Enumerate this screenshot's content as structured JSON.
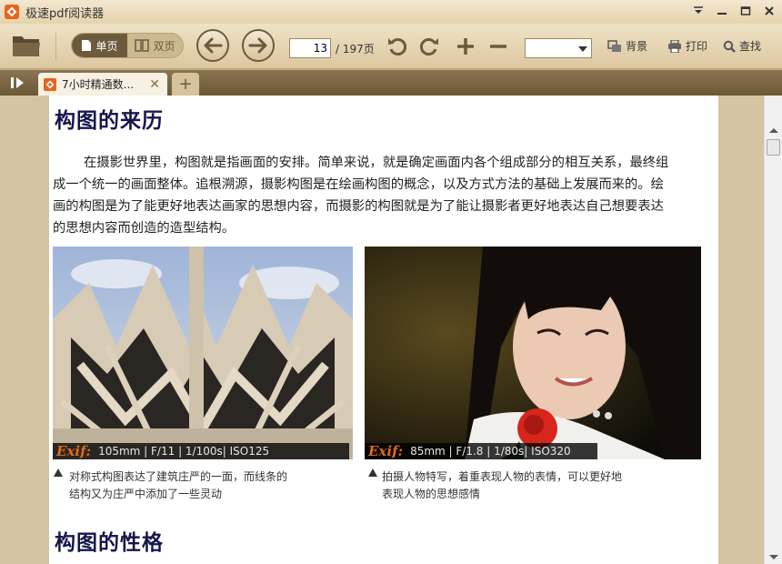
{
  "window": {
    "title": "极速pdf阅读器"
  },
  "toolbar": {
    "single_page_label": "单页",
    "double_page_label": "双页",
    "current_page": "13",
    "total_pages": "/ 197页",
    "zoom_value": "",
    "background_label": "背景",
    "print_label": "打印",
    "search_label": "查找"
  },
  "tabs": [
    {
      "label": "7小时精通数..."
    }
  ],
  "document": {
    "heading1": "构图的来历",
    "paragraph": "在摄影世界里，构图就是指画面的安排。简单来说，就是确定画面内各个组成部分的相互关系，最终组成一个统一的画面整体。追根溯源，摄影构图是在绘画构图的概念，以及方式方法的基础上发展而来的。绘画的构图是为了能更好地表达画家的思想内容，而摄影的构图就是为了能让摄影者更好地表达自己想要表达的思想内容而创造的造型结构。",
    "photo_left": {
      "exif_logo": "Exif:",
      "exif": "105mm | F/11 | 1/100s| ISO125",
      "caption_line1": "对称式构图表达了建筑庄严的一面，而线条的",
      "caption_line2": "结构又为庄严中添加了一些灵动"
    },
    "photo_right": {
      "exif_logo": "Exif:",
      "exif": "85mm | F/1.8 | 1/80s| ISO320",
      "caption_line1": "拍摄人物特写，着重表现人物的表情，可以更好地",
      "caption_line2": "表现人物的思想感情"
    },
    "heading2": "构图的性格"
  },
  "colors": {
    "accent": "#e8641c",
    "heading": "#16164d",
    "toolbar_dark": "#6d5a3c"
  },
  "icons": {
    "app": "app-logo-icon",
    "open": "folder-icon",
    "prev": "arrow-left-icon",
    "next": "arrow-right-icon",
    "rotate_left": "rotate-ccw-icon",
    "rotate_right": "rotate-cw-icon",
    "zoom_in": "plus-icon",
    "zoom_out": "minus-icon",
    "background": "background-icon",
    "print": "printer-icon",
    "search": "search-icon"
  }
}
